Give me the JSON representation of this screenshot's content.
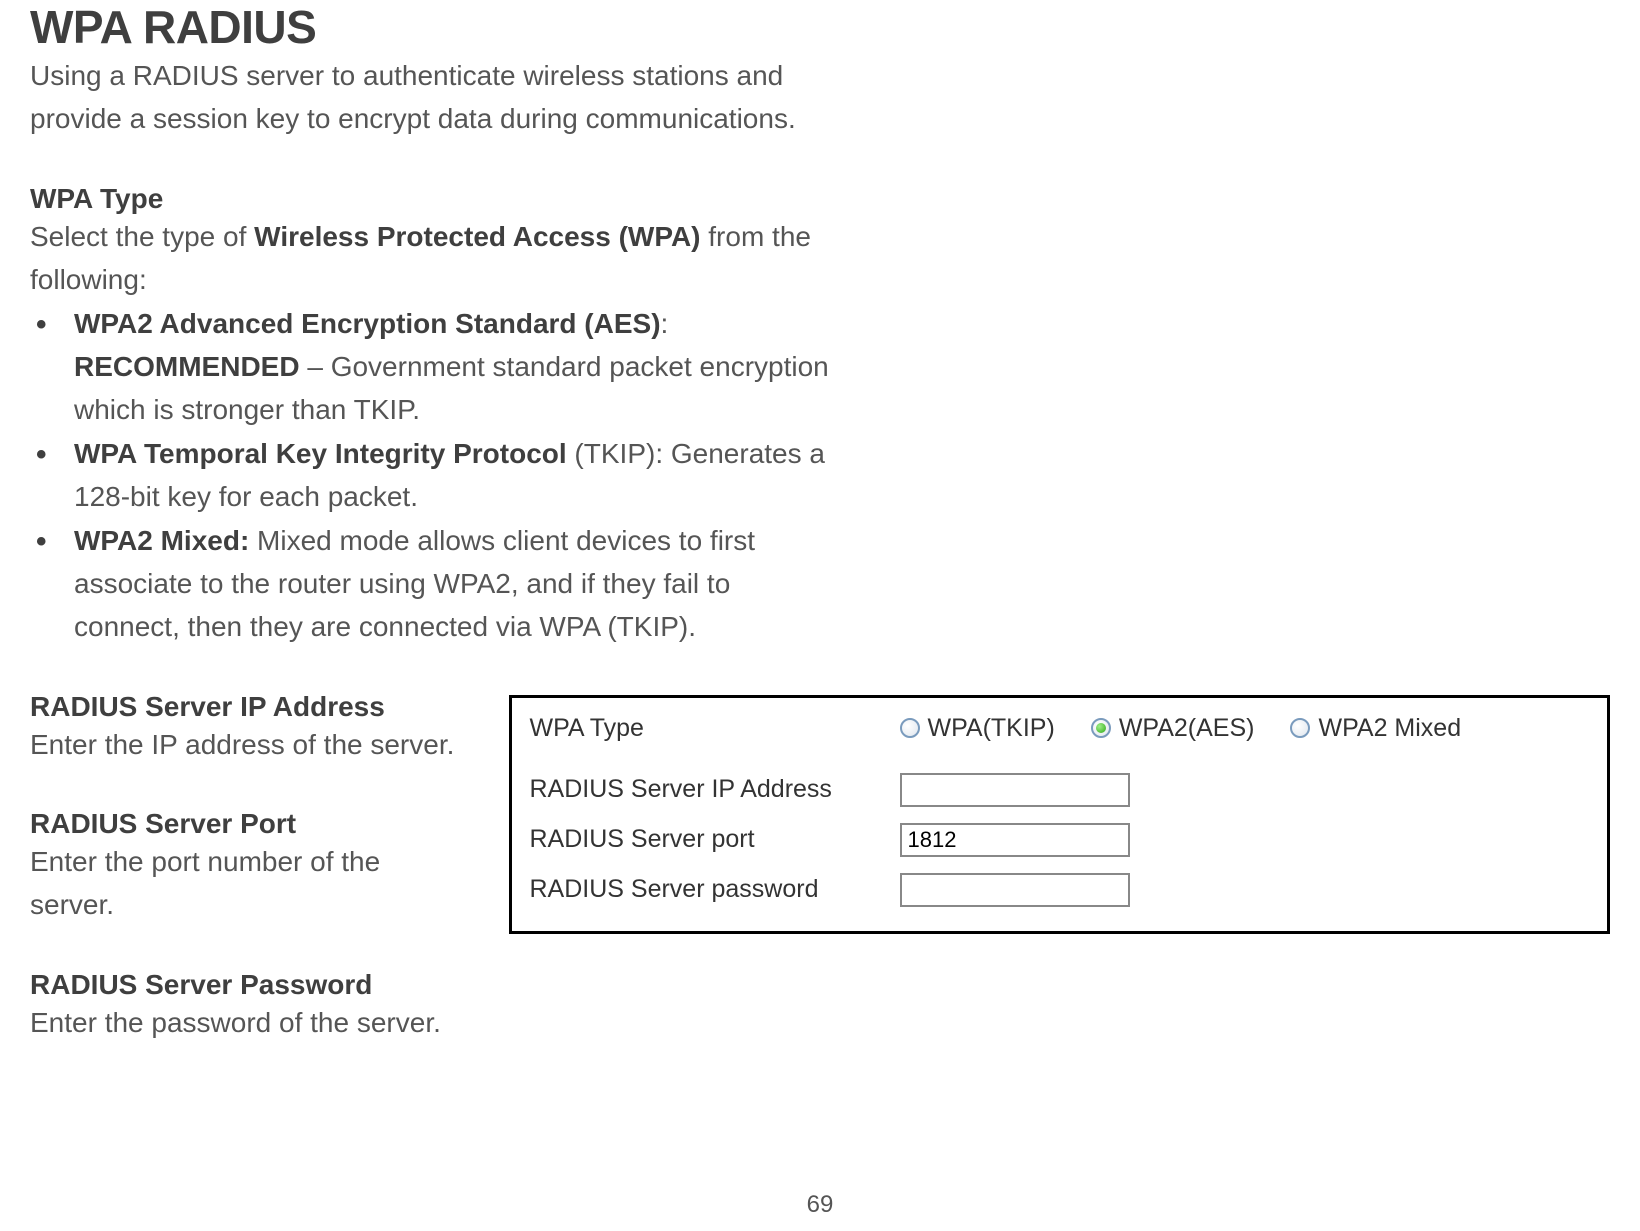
{
  "title": "WPA RADIUS",
  "intro_l1": "Using a RADIUS server to authenticate wireless stations and",
  "intro_l2": "provide a session key to encrypt data during communications.",
  "wpaType": {
    "heading": "WPA Type",
    "lead_pre": "Select the type of ",
    "lead_bold": "Wireless Protected Access (WPA)",
    "lead_post": " from the",
    "lead_l2": "following:",
    "items": [
      {
        "b1": "WPA2 Advanced Encryption Standard (AES)",
        "p1": ":",
        "b2": "RECOMMENDED",
        "p2": " – Government standard packet encryption",
        "l3": "which is stronger than TKIP."
      },
      {
        "b1": "WPA Temporal Key Integrity Protocol",
        "p1": " (TKIP): Generates a",
        "l2": "128-bit key for each packet."
      },
      {
        "b1": "WPA2 Mixed:",
        "p1": " Mixed mode allows client devices to first",
        "l2": "associate to the router using WPA2, and if they fail to",
        "l3": "connect, then they are connected via WPA (TKIP)."
      }
    ]
  },
  "left": {
    "ip_h": "RADIUS Server IP Address",
    "ip_d": "Enter the IP address of the server.",
    "port_h": "RADIUS Server Port",
    "port_d": "Enter the port number of the server.",
    "pw_h": "RADIUS Server Password",
    "pw_d": "Enter the password of the server."
  },
  "panel": {
    "wpaTypeLabel": "WPA Type",
    "options": {
      "tkip": "WPA(TKIP)",
      "aes": "WPA2(AES)",
      "mixed": "WPA2 Mixed"
    },
    "selected": "aes",
    "ipLabel": "RADIUS Server IP Address",
    "ipValue": "",
    "portLabel": "RADIUS Server port",
    "portValue": "1812",
    "pwLabel": "RADIUS Server password",
    "pwValue": ""
  },
  "pageNumber": "69"
}
